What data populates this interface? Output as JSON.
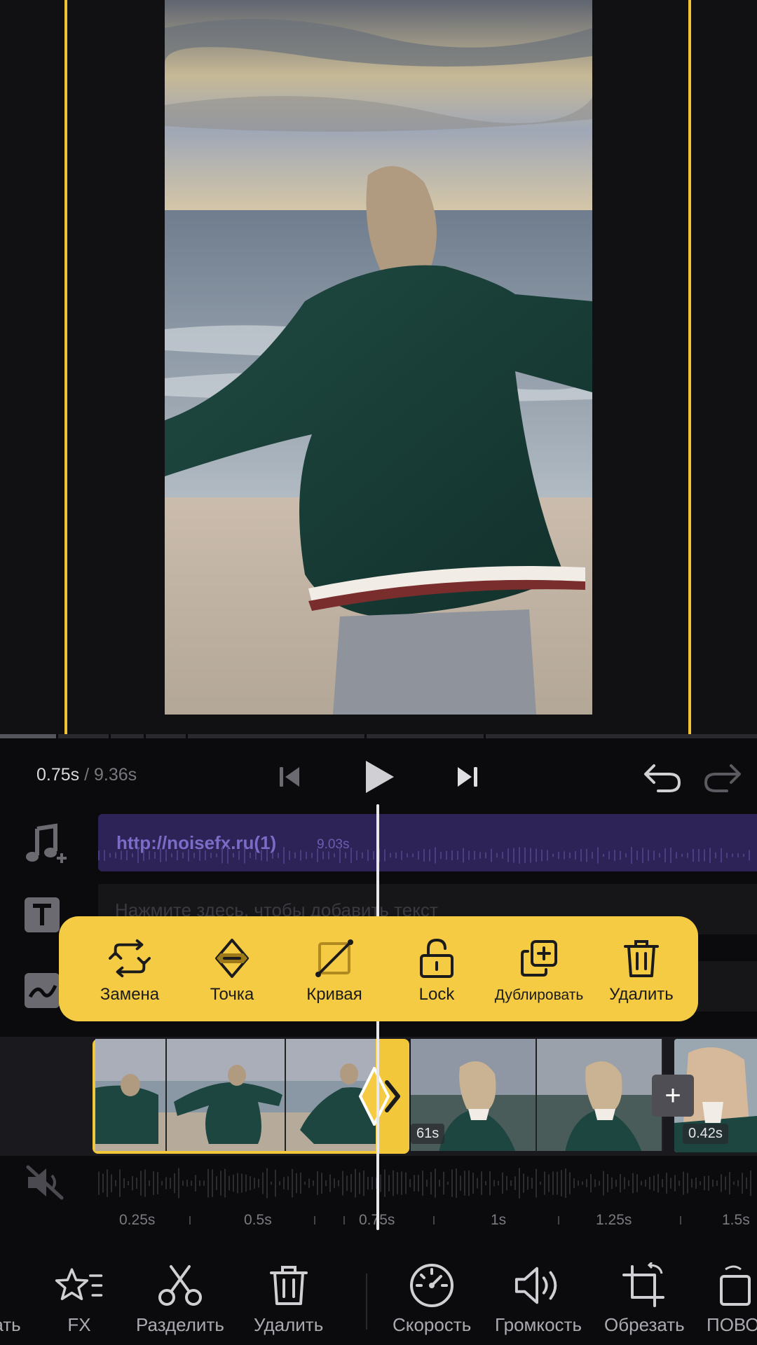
{
  "player": {
    "current_time": "0.75s",
    "separator": " / ",
    "total_time": "9.36s",
    "icons": [
      "skip-back-icon",
      "play-icon",
      "skip-forward-icon",
      "undo-icon",
      "redo-icon"
    ]
  },
  "tracks": {
    "music": {
      "title": "http://noisefx.ru(1)",
      "duration": "9.03s"
    },
    "text": {
      "placeholder": "Нажмите здесь, чтобы добавить текст"
    }
  },
  "clips": {
    "second_badge": "61s",
    "third_badge": "0.42s",
    "add_transition": "+"
  },
  "ruler": {
    "labels": [
      "0.25s",
      "0.5s",
      "0.75s",
      "1s",
      "1.25s",
      "1.5s"
    ]
  },
  "popup": {
    "items": [
      {
        "label": "Замена",
        "icon": "replace-icon"
      },
      {
        "label": "Точка",
        "icon": "keyframe-icon"
      },
      {
        "label": "Кривая",
        "icon": "curve-icon"
      },
      {
        "label": "Lock",
        "icon": "lock-icon"
      },
      {
        "label": "Дублировать",
        "icon": "duplicate-icon"
      },
      {
        "label": "Удалить",
        "icon": "trash-icon"
      }
    ]
  },
  "bottom_toolbar": {
    "items": [
      {
        "label": "ать",
        "icon": ""
      },
      {
        "label": "FX",
        "icon": "fx-star-icon"
      },
      {
        "label": "Разделить",
        "icon": "scissors-icon"
      },
      {
        "label": "Удалить",
        "icon": "trash-icon"
      },
      {
        "label": "Скорость",
        "icon": "speedometer-icon"
      },
      {
        "label": "Громкость",
        "icon": "volume-icon"
      },
      {
        "label": "Обрезать",
        "icon": "crop-icon"
      },
      {
        "label": "ПОВО",
        "icon": "rotate-icon"
      }
    ]
  },
  "colors": {
    "accent": "#f5cb44",
    "music_track": "#2d2356",
    "background": "#0b0b0d"
  }
}
